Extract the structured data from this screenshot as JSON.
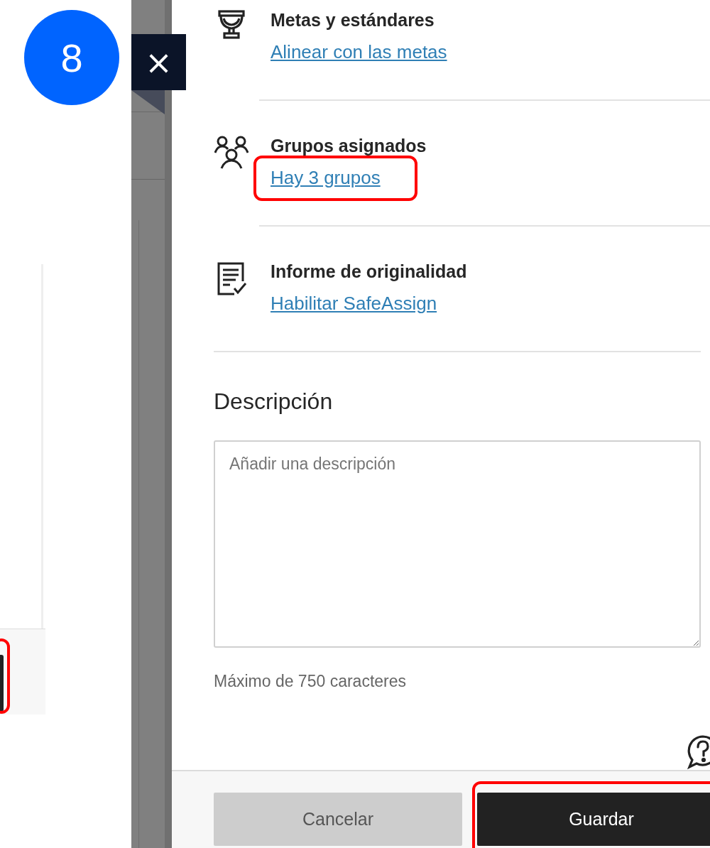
{
  "step_badge": "8",
  "close_button": {
    "label": "×"
  },
  "background_page": {
    "button_highlighted": true
  },
  "panel": {
    "items": [
      {
        "kind": "goals",
        "heading": "Metas y estándares",
        "link": "Alinear con las metas",
        "highlighted": false
      },
      {
        "kind": "groups",
        "heading": "Grupos asignados",
        "link": "Hay 3 grupos",
        "highlighted": true
      },
      {
        "kind": "originality",
        "heading": "Informe de originalidad",
        "link": "Habilitar SafeAssign",
        "highlighted": false
      }
    ],
    "description": {
      "heading": "Descripción",
      "placeholder": "Añadir una descripción",
      "hint": "Máximo de 750 caracteres"
    },
    "buttons": [
      {
        "label": "Cancelar",
        "kind": "secondary",
        "highlighted": false
      },
      {
        "label": "Guardar",
        "kind": "primary",
        "highlighted": true
      }
    ]
  }
}
